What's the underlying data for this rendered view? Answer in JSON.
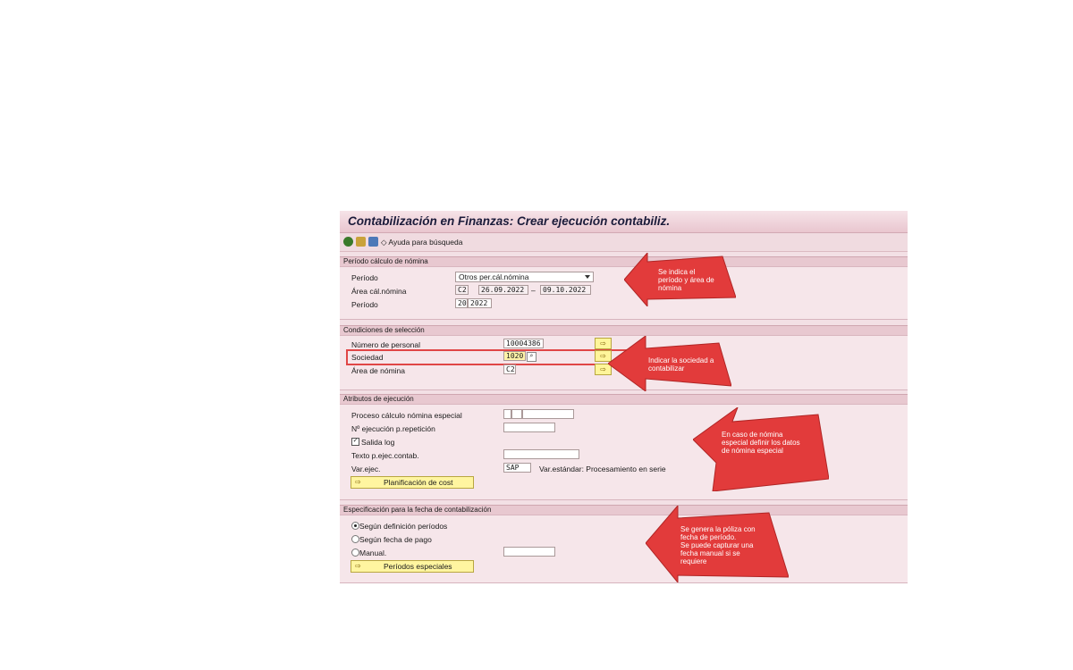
{
  "window": {
    "title": "Contabilización en Finanzas: Crear ejecución contabiliz.",
    "toolbar": {
      "icons": [
        "execute-icon",
        "get-variant-icon",
        "program-doc-icon"
      ],
      "search_help": "◇ Ayuda para búsqueda"
    }
  },
  "sections": {
    "period": {
      "header": "Período cálculo de nómina",
      "periodo_label": "Período",
      "periodo_select": "Otros per.cál.nómina",
      "area_label": "Área cál.nómina",
      "area_code": "C2",
      "date_from": "26.09.2022",
      "date_sep": "–",
      "date_to": "09.10.2022",
      "periodo2_label": "Período",
      "period_num": "20",
      "period_year": "2022"
    },
    "selection": {
      "header": "Condiciones de selección",
      "personal_label": "Número de personal",
      "personal_value": "10004386",
      "sociedad_label": "Sociedad",
      "sociedad_value": "1020",
      "area_label": "Área de nómina",
      "area_value": "C2"
    },
    "attributes": {
      "header": "Atributos de ejecución",
      "special_label": "Proceso cálculo nómina especial",
      "repeat_label": "Nº ejecución p.repetición",
      "log_label": "Salida log",
      "log_checked": "✓",
      "text_label": "Texto p.ejec.contab.",
      "variant_label": "Var.ejec.",
      "variant_value": "SAP",
      "variant_desc": "Var.estándar: Procesamiento en serie",
      "plan_button": "Planificación de cost"
    },
    "posting_date": {
      "header": "Especificación para la fecha de contabilización",
      "opt1": "Según definición períodos",
      "opt2": "Según fecha de pago",
      "opt3": "Manual.",
      "special_button": "Períodos especiales"
    }
  },
  "callouts": {
    "c1": [
      "Se indica el",
      "período y área de",
      "nómina"
    ],
    "c2": [
      "Indicar la sociedad a",
      "contabilizar"
    ],
    "c3": [
      "En caso de nómina",
      "especial definir los datos",
      "de nómina especial"
    ],
    "c4": [
      "Se genera la póliza con",
      "fecha de período.",
      "Se puede capturar una",
      "fecha manual si se",
      "requiere"
    ]
  },
  "colors": {
    "callout_red": "#e23b3b",
    "highlight_border": "#e04646",
    "panel_bg": "#f6e6ea"
  }
}
